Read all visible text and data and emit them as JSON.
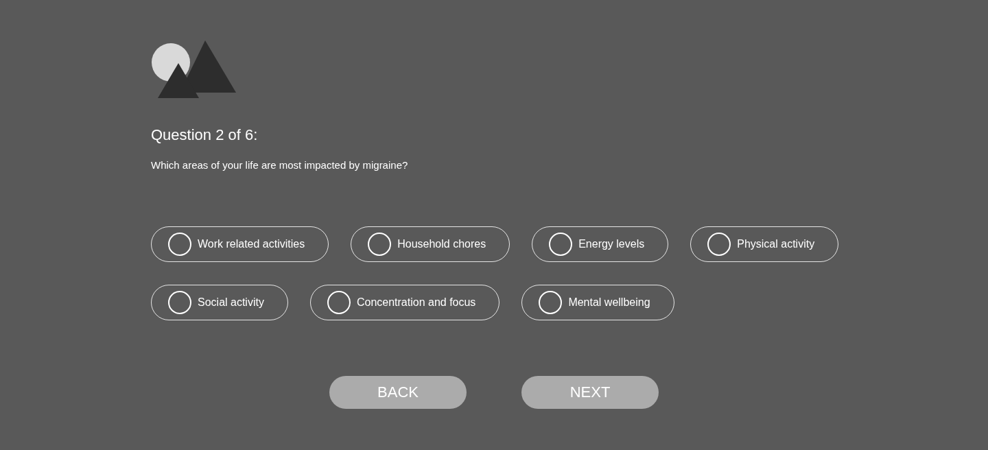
{
  "question": {
    "title": "Question 2 of 6:",
    "text": "Which areas of your life are most impacted by migraine?"
  },
  "option_rows": [
    {
      "options": [
        {
          "label": "Work related activities",
          "selected": false
        },
        {
          "label": "Household chores",
          "selected": false
        },
        {
          "label": "Energy levels",
          "selected": false
        },
        {
          "label": "Physical activity",
          "selected": false
        }
      ]
    },
    {
      "options": [
        {
          "label": "Social activity",
          "selected": false
        },
        {
          "label": "Concentration and focus",
          "selected": false
        },
        {
          "label": "Mental wellbeing",
          "selected": false
        }
      ]
    }
  ],
  "buttons": [
    "BACK",
    "NEXT"
  ]
}
